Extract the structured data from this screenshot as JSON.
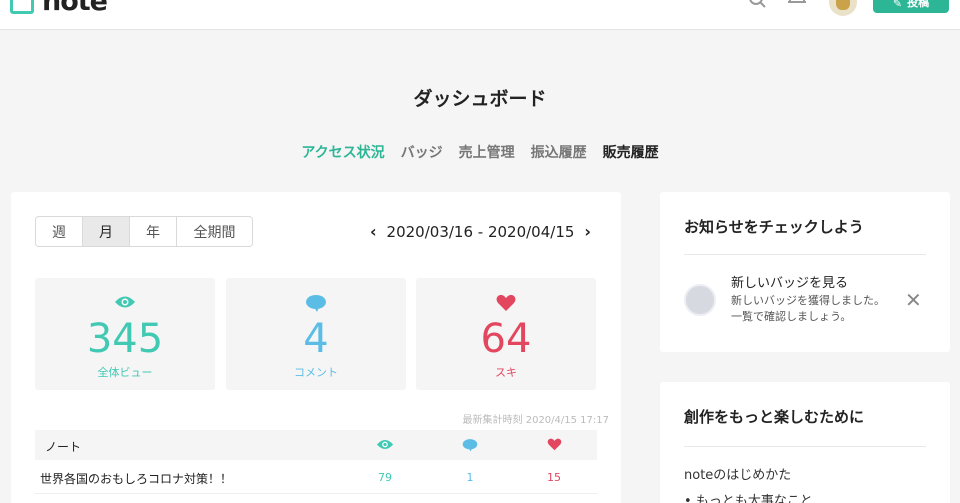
{
  "header": {
    "logo_text": "note",
    "post_button_label": "投稿"
  },
  "page": {
    "title": "ダッシュボード",
    "tabs": [
      {
        "label": "アクセス状況"
      },
      {
        "label": "バッジ"
      },
      {
        "label": "売上管理"
      },
      {
        "label": "振込履歴"
      },
      {
        "label": "販売履歴"
      }
    ]
  },
  "period": {
    "options": [
      "週",
      "月",
      "年",
      "全期間"
    ],
    "selected": "月",
    "range": "2020/03/16 - 2020/04/15"
  },
  "stats": {
    "views": {
      "value": "345",
      "label": "全体ビュー"
    },
    "comments": {
      "value": "4",
      "label": "コメント"
    },
    "likes": {
      "value": "64",
      "label": "スキ"
    }
  },
  "table": {
    "updated": "最新集計時刻 2020/4/15 17:17",
    "header": "ノート",
    "rows": [
      {
        "title": "世界各国のおもしろコロナ対策！！",
        "views": "79",
        "comments": "1",
        "likes": "15"
      }
    ]
  },
  "notice": {
    "title": "お知らせをチェックしよう",
    "item_title": "新しいバッジを見る",
    "item_desc": "新しいバッジを獲得しました。一覧で確認しましょう。"
  },
  "creative": {
    "title": "創作をもっと楽しむために",
    "link": "noteのはじめかた",
    "bullet": "もっとも大事なこと"
  },
  "colors": {
    "accent": "#2cb696",
    "views": "#41c9b4",
    "comments": "#5bbde6",
    "likes": "#e3475f"
  }
}
